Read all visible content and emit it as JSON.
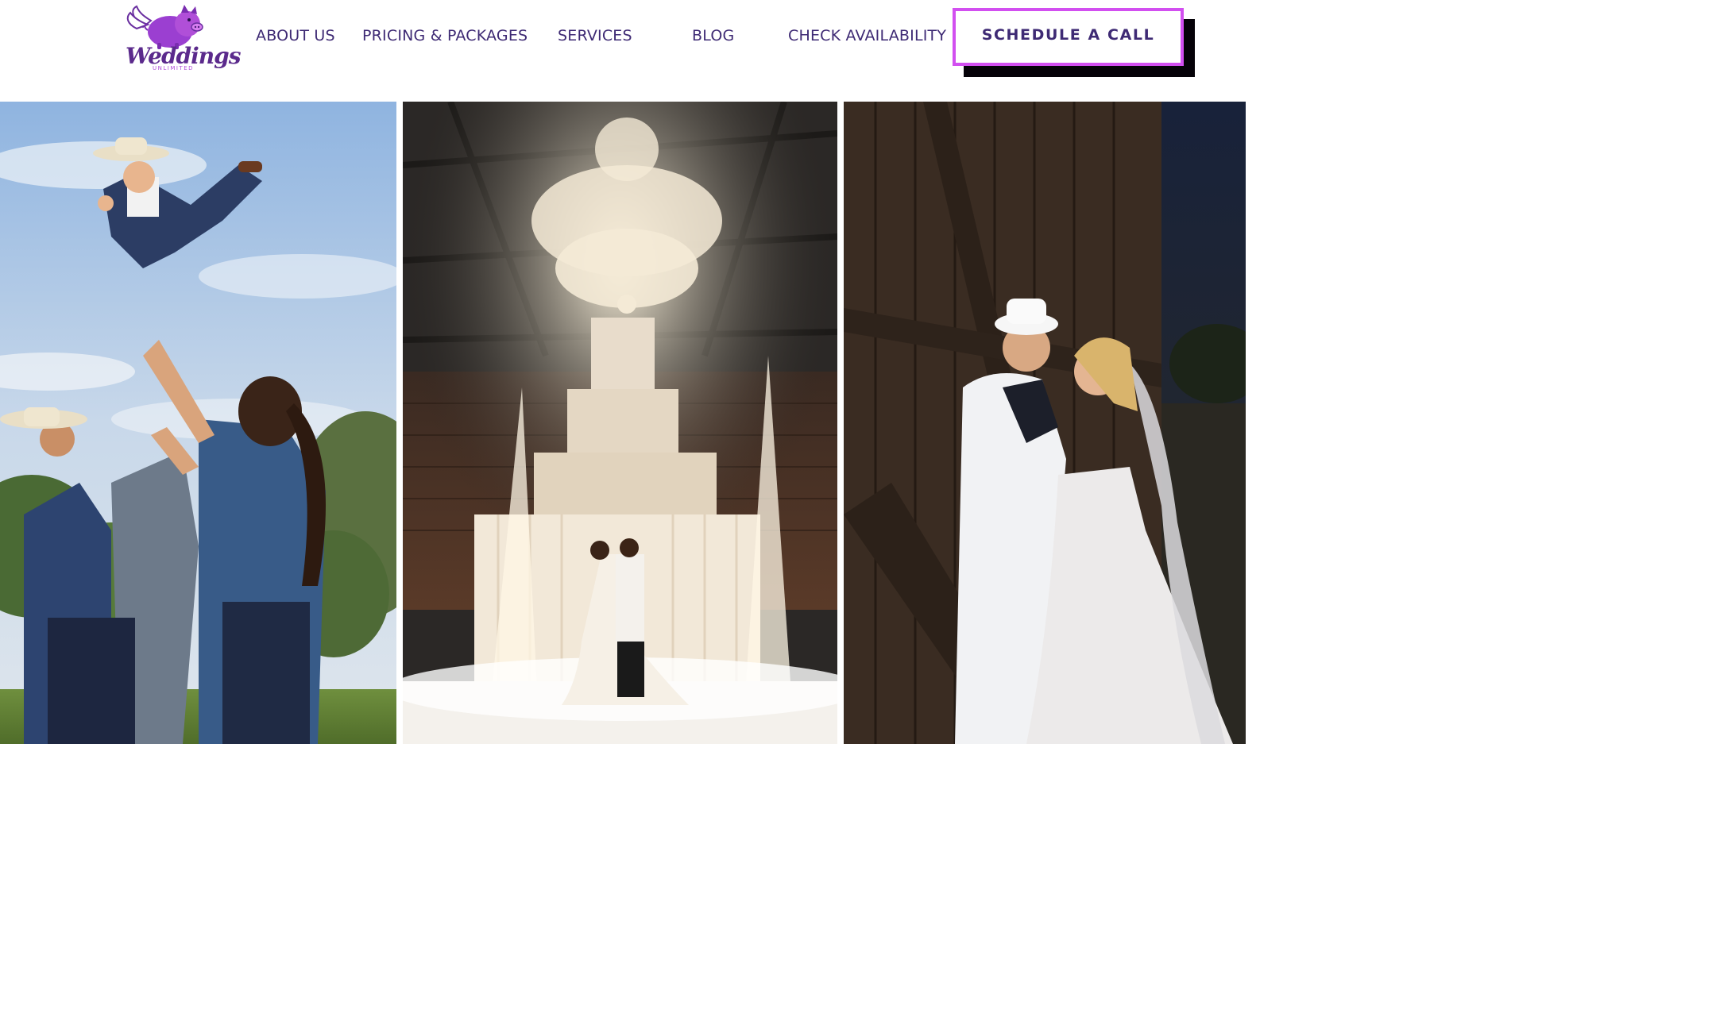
{
  "brand": {
    "name": "Weddings",
    "tagline": "UNLIMITED",
    "logo_icon": "flying-pig-icon",
    "colors": {
      "primary": "#3e2a74",
      "accent": "#d24ff0",
      "logo_purple": "#9b3fd1",
      "shadow": "#050208"
    }
  },
  "nav": {
    "items": [
      {
        "label": "ABOUT US"
      },
      {
        "label": "PRICING & PACKAGES"
      },
      {
        "label": "SERVICES"
      },
      {
        "label": "BLOG"
      },
      {
        "label": "CHECK AVAILABILITY"
      }
    ],
    "cta_label": "SCHEDULE A CALL"
  },
  "gallery": {
    "photos": [
      {
        "scene": "groomsmen tossing groom in the air outdoors"
      },
      {
        "scene": "couple first dance under chandelier with sparklers"
      },
      {
        "scene": "sailor groom and bride embracing by barn"
      }
    ]
  }
}
